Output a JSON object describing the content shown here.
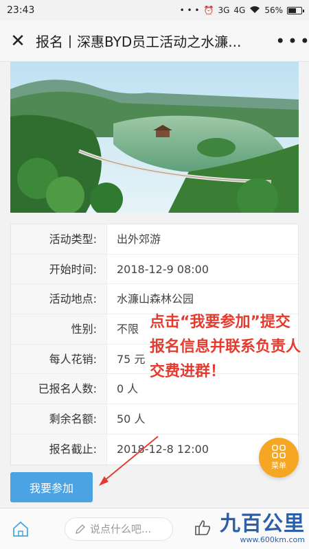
{
  "status": {
    "time": "23:43",
    "dots": "• • •",
    "net1": "3G",
    "net2": "4G",
    "battery": "56%"
  },
  "header": {
    "title": "报名丨深惠BYD员工活动之水濂..."
  },
  "details": [
    {
      "label": "活动类型:",
      "value": "出外郊游"
    },
    {
      "label": "开始时间:",
      "value": "2018-12-9 08:00"
    },
    {
      "label": "活动地点:",
      "value": "水濂山森林公园"
    },
    {
      "label": "性别:",
      "value": "不限"
    },
    {
      "label": "每人花销:",
      "value": "75 元"
    },
    {
      "label": "已报名人数:",
      "value": "0 人"
    },
    {
      "label": "剩余名额:",
      "value": "50 人"
    },
    {
      "label": "报名截止:",
      "value": "2018-12-8 12:00"
    }
  ],
  "note": "点击“我要参加”提交报名信息并联系负责人交费进群！",
  "join_button": "我要参加",
  "menu_label": "菜单",
  "comment_placeholder": "说点什么吧...",
  "watermark": {
    "brand": "九百公里",
    "url": "www.600km.com"
  },
  "colors": {
    "accent": "#4ba3e3",
    "note": "#e53a2e",
    "fab": "#f5a623"
  }
}
